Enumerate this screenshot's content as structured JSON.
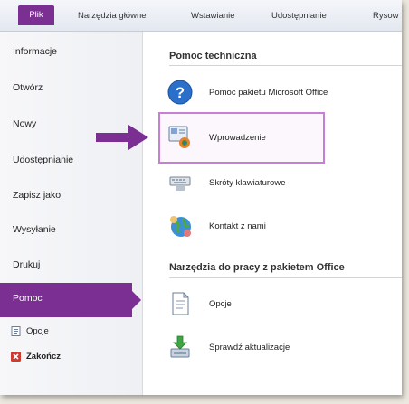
{
  "tabs": [
    {
      "label": "Plik"
    },
    {
      "label": "Narzędzia główne"
    },
    {
      "label": "Wstawianie"
    },
    {
      "label": "Udostępnianie"
    },
    {
      "label": "Rysow"
    }
  ],
  "nav": {
    "items": [
      {
        "label": "Informacje"
      },
      {
        "label": "Otwórz"
      },
      {
        "label": "Nowy"
      },
      {
        "label": "Udostępnianie"
      },
      {
        "label": "Zapisz jako"
      },
      {
        "label": "Wysyłanie"
      },
      {
        "label": "Drukuj"
      }
    ],
    "active_label": "Pomoc",
    "sub_items": [
      {
        "label": "Opcje",
        "icon": "options-icon"
      },
      {
        "label": "Zakończ",
        "icon": "exit-icon"
      }
    ]
  },
  "help": {
    "section_title": "Pomoc techniczna",
    "items": [
      {
        "label": "Pomoc pakietu Microsoft Office",
        "icon": "help-icon"
      },
      {
        "label": "Wprowadzenie",
        "icon": "getting-started-icon"
      },
      {
        "label": "Skróty klawiaturowe",
        "icon": "keyboard-icon"
      },
      {
        "label": "Kontakt z nami",
        "icon": "contact-globe-icon"
      }
    ]
  },
  "tools": {
    "section_title": "Narzędzia do pracy z pakietem Office",
    "items": [
      {
        "label": "Opcje",
        "icon": "document-options-icon"
      },
      {
        "label": "Sprawdź aktualizacje",
        "icon": "update-icon"
      }
    ]
  },
  "colors": {
    "accent": "#7b2f93",
    "highlight_border": "#c57fd3",
    "help_blue": "#2a6fc9"
  }
}
